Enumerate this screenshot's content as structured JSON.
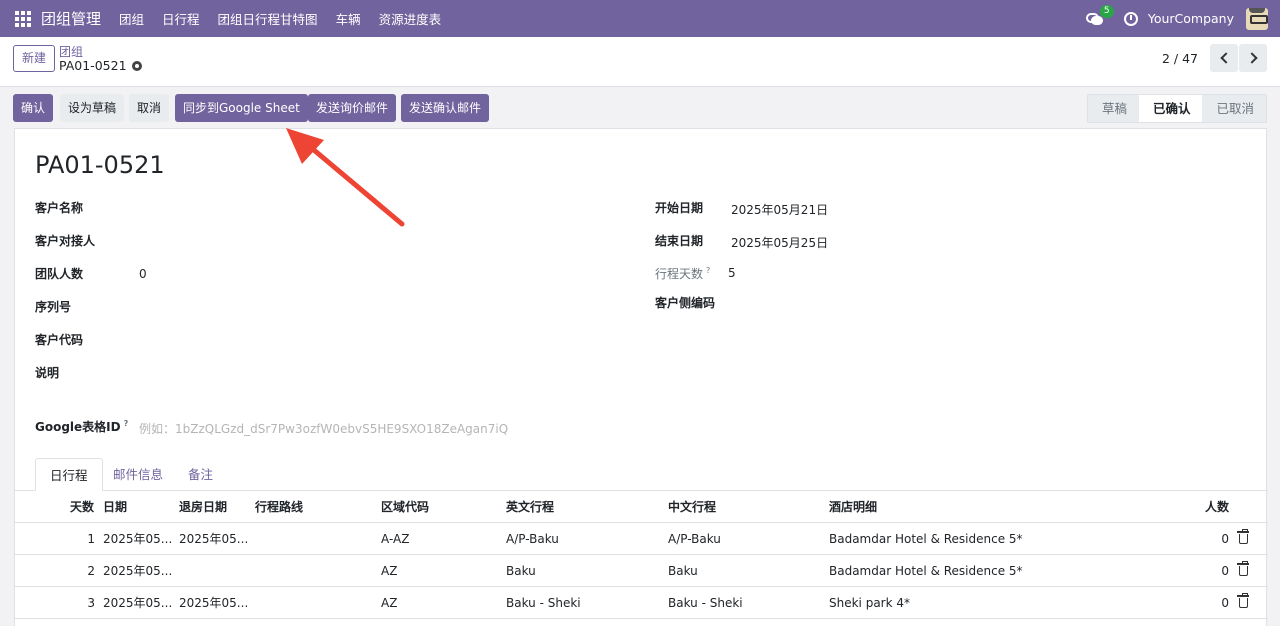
{
  "topbar": {
    "app_title": "团组管理",
    "menu": [
      "团组",
      "日行程",
      "团组日行程甘特图",
      "车辆",
      "资源进度表"
    ],
    "chat_count": "5",
    "company": "YourCompany"
  },
  "control_panel": {
    "new_label": "新建",
    "breadcrumb_parent": "团组",
    "breadcrumb_current": "PA01-0521",
    "pager": "2 / 47"
  },
  "actions": {
    "confirm": "确认",
    "set_draft": "设为草稿",
    "cancel": "取消",
    "sync_google": "同步到Google Sheet",
    "send_inquiry": "发送询价邮件",
    "send_confirm": "发送确认邮件"
  },
  "status_bar": {
    "stages": [
      "草稿",
      "已确认",
      "已取消"
    ],
    "active": "已确认"
  },
  "form": {
    "title": "PA01-0521",
    "left": {
      "customer_name_label": "客户名称",
      "customer_contact_label": "客户对接人",
      "team_size_label": "团队人数",
      "team_size_value": "0",
      "serial_label": "序列号",
      "customer_code_label": "客户代码",
      "notes_label": "说明"
    },
    "right": {
      "start_date_label": "开始日期",
      "start_date_value": "2025年05月21日",
      "end_date_label": "结束日期",
      "end_date_value": "2025年05月25日",
      "days_label": "行程天数",
      "days_value": "5",
      "client_code_label": "客户侧编码"
    },
    "google_id_label": "Google表格ID",
    "google_id_placeholder": "例如：1bZzQLGzd_dSr7Pw3ozfW0ebvS5HE9SXO18ZeAgan7iQ"
  },
  "tabs": [
    "日行程",
    "邮件信息",
    "备注"
  ],
  "table": {
    "headers": [
      "天数",
      "日期",
      "退房日期",
      "行程路线",
      "区域代码",
      "英文行程",
      "中文行程",
      "酒店明细",
      "人数"
    ],
    "rows": [
      {
        "day": "1",
        "date": "2025年05...",
        "checkout": "2025年05...",
        "route": "",
        "region": "A-AZ",
        "en": "A/P-Baku",
        "cn": "A/P-Baku",
        "hotel": "Badamdar Hotel & Residence 5*",
        "pax": "0"
      },
      {
        "day": "2",
        "date": "2025年05...",
        "checkout": "",
        "route": "",
        "region": "AZ",
        "en": "Baku",
        "cn": "Baku",
        "hotel": "Badamdar Hotel & Residence 5*",
        "pax": "0"
      },
      {
        "day": "3",
        "date": "2025年05...",
        "checkout": "2025年05...",
        "route": "",
        "region": "AZ",
        "en": "Baku - Sheki",
        "cn": "Baku - Sheki",
        "hotel": "Sheki park 4*",
        "pax": "0"
      }
    ]
  },
  "colors": {
    "brand": "#71639e",
    "annotation_arrow": "#ee4433"
  }
}
